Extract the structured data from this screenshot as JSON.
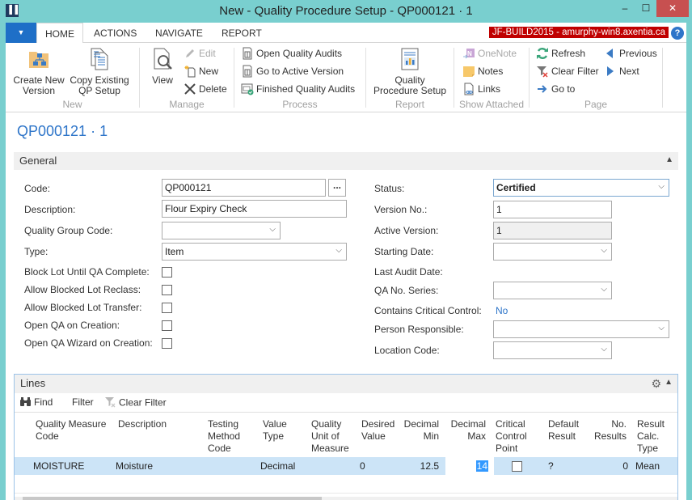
{
  "window": {
    "title": "New - Quality Procedure Setup - QP000121 · 1",
    "logo_glyph": "▐▐",
    "minimize_glyph": "–",
    "maximize_glyph": "☐",
    "close_glyph": "✕"
  },
  "ribbon_tabs": {
    "file_glyph": "▼",
    "items": [
      "HOME",
      "ACTIONS",
      "NAVIGATE",
      "REPORT"
    ],
    "active": "HOME",
    "server_badge": "JF-BUILD2015 - amurphy-win8.axentia.ca",
    "help_glyph": "?"
  },
  "ribbon": {
    "groups": {
      "new": {
        "label": "New",
        "create_new_version": "Create New Version",
        "create_new_version_l1": "Create New",
        "create_new_version_l2": "Version",
        "copy_existing_l1": "Copy Existing",
        "copy_existing_l2": "QP Setup"
      },
      "manage": {
        "label": "Manage",
        "view": "View",
        "edit": "Edit",
        "new": "New",
        "delete": "Delete"
      },
      "process": {
        "label": "Process",
        "open_quality_audits": "Open Quality Audits",
        "go_to_active_version": "Go to Active Version",
        "finished_quality_audits": "Finished Quality Audits"
      },
      "report": {
        "label": "Report",
        "qps_l1": "Quality",
        "qps_l2": "Procedure Setup"
      },
      "show_attached": {
        "label": "Show Attached",
        "onenote": "OneNote",
        "notes": "Notes",
        "links": "Links"
      },
      "page": {
        "label": "Page",
        "refresh": "Refresh",
        "clear_filter": "Clear Filter",
        "go_to": "Go to",
        "previous": "Previous",
        "next": "Next"
      }
    }
  },
  "page": {
    "title": "QP000121 · 1"
  },
  "general": {
    "title": "General",
    "collapse_glyph": "▲",
    "left": {
      "code_label": "Code:",
      "code_value": "QP000121",
      "assist_glyph": "...",
      "description_label": "Description:",
      "description_value": "Flour Expiry Check",
      "quality_group_code_label": "Quality Group Code:",
      "quality_group_code_value": "",
      "type_label": "Type:",
      "type_value": "Item",
      "block_lot_label": "Block Lot Until QA Complete:",
      "block_lot_checked": false,
      "allow_reclass_label": "Allow Blocked Lot Reclass:",
      "allow_reclass_checked": false,
      "allow_transfer_label": "Allow Blocked Lot Transfer:",
      "allow_transfer_checked": false,
      "open_qa_label": "Open QA on Creation:",
      "open_qa_checked": false,
      "open_qa_wizard_label": "Open QA Wizard on Creation:",
      "open_qa_wizard_checked": false
    },
    "right": {
      "status_label": "Status:",
      "status_value": "Certified",
      "version_no_label": "Version No.:",
      "version_no_value": "1",
      "active_version_label": "Active Version:",
      "active_version_value": "1",
      "starting_date_label": "Starting Date:",
      "starting_date_value": "",
      "last_audit_date_label": "Last Audit Date:",
      "qa_no_series_label": "QA No. Series:",
      "qa_no_series_value": "",
      "contains_critical_label": "Contains Critical Control:",
      "contains_critical_value": "No",
      "person_responsible_label": "Person Responsible:",
      "person_responsible_value": "",
      "location_code_label": "Location Code:",
      "location_code_value": ""
    },
    "dropdown_glyph": "⌵"
  },
  "lines": {
    "title": "Lines",
    "toolbar": {
      "find": "Find",
      "filter": "Filter",
      "clear_filter": "Clear Filter"
    },
    "gear_glyph": "⚙",
    "columns": [
      {
        "l1": "Quality Measure",
        "l2": "Code",
        "l3": ""
      },
      {
        "l1": "Description",
        "l2": "",
        "l3": ""
      },
      {
        "l1": "Testing",
        "l2": "Method",
        "l3": "Code"
      },
      {
        "l1": "Value",
        "l2": "Type",
        "l3": ""
      },
      {
        "l1": "Quality",
        "l2": "Unit of",
        "l3": "Measure"
      },
      {
        "l1": "Desired",
        "l2": "Value",
        "l3": ""
      },
      {
        "l1": "Decimal",
        "l2": "Min",
        "l3": ""
      },
      {
        "l1": "Decimal",
        "l2": "Max",
        "l3": ""
      },
      {
        "l1": "Critical",
        "l2": "Control",
        "l3": "Point"
      },
      {
        "l1": "Default",
        "l2": "Result",
        "l3": ""
      },
      {
        "l1": "No.",
        "l2": "Results",
        "l3": ""
      },
      {
        "l1": "Result",
        "l2": "Calc.",
        "l3": "Type"
      }
    ],
    "rows": [
      {
        "quality_measure_code": "MOISTURE",
        "description": "Moisture",
        "testing_method_code": "",
        "value_type": "Decimal",
        "quality_uom": "",
        "desired_value": "0",
        "decimal_min": "12.5",
        "decimal_max": "14",
        "critical_control_point": false,
        "default_result": "?",
        "no_results": "0",
        "result_calc_type": "Mean"
      }
    ]
  }
}
